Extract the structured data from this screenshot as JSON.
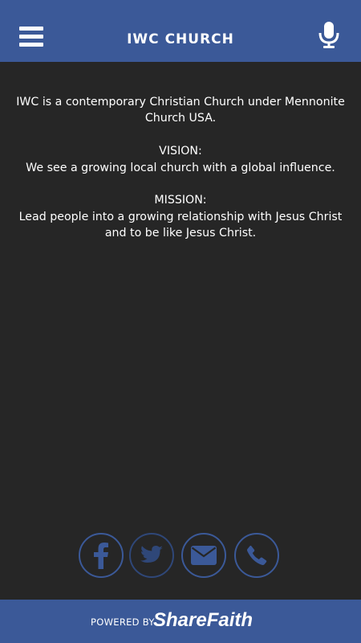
{
  "colors": {
    "header_bg": "#3b5998",
    "body_bg": "#262626",
    "icon_blue": "#3b5998",
    "text": "#ffffff"
  },
  "header": {
    "menu_icon": "hamburger-menu-icon",
    "title": "IWC CHURCH",
    "mic_icon": "microphone-icon"
  },
  "content": {
    "intro": "IWC is a contemporary Christian Church under Mennonite Church USA.",
    "vision_heading": "VISION:",
    "vision_text": "We see a growing local church with a global influence.",
    "mission_heading": "MISSION:",
    "mission_text": "Lead people into a growing relationship with Jesus Christ and to be like Jesus Christ."
  },
  "social": [
    {
      "icon": "facebook-icon"
    },
    {
      "icon": "twitter-icon"
    },
    {
      "icon": "email-icon"
    },
    {
      "icon": "phone-icon"
    }
  ],
  "footer": {
    "powered_by": "POWERED BY",
    "brand": "ShareFaith"
  }
}
